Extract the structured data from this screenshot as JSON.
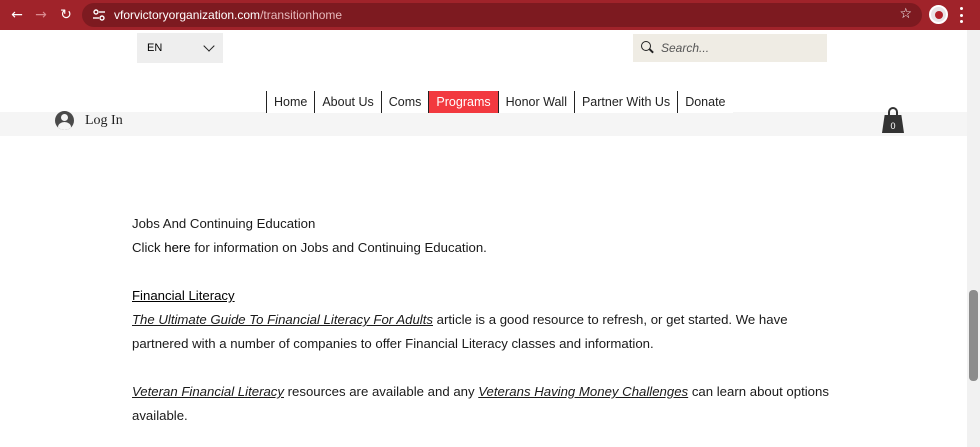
{
  "browser": {
    "url_host": "vforvictoryorganization.com",
    "url_path": "/transitionhome",
    "accent_color": "#a0232a"
  },
  "header": {
    "language": "EN",
    "search_placeholder": "Search...",
    "login_label": "Log In",
    "cart_count": "0"
  },
  "nav": {
    "items": [
      {
        "label": "Home"
      },
      {
        "label": "About Us"
      },
      {
        "label": "Coms"
      },
      {
        "label": "Programs",
        "active": true
      },
      {
        "label": "Honor Wall"
      },
      {
        "label": "Partner With Us"
      },
      {
        "label": "Donate"
      }
    ],
    "active_color": "#f2393f"
  },
  "content": {
    "jobs_title": "Jobs And Continuing Education",
    "jobs_click": "Click ",
    "jobs_here": "here",
    "jobs_rest": " for information on Jobs and Continuing Education.",
    "fin_heading": "Financial Literacy",
    "fin_guide_link": "The Ultimate Guide To Financial Literacy For Adults",
    "fin_guide_rest": " article is a good resource to refresh, or get started. We have",
    "fin_line2": "partnered with a number of companies to offer Financial Literacy classes and information.",
    "vet_link1": "Veteran Financial Literacy",
    "vet_mid": " resources are available and any ",
    "vet_link2": "Veterans Having Money Challenges",
    "vet_rest": " can learn about options",
    "vet_line2": "available."
  }
}
